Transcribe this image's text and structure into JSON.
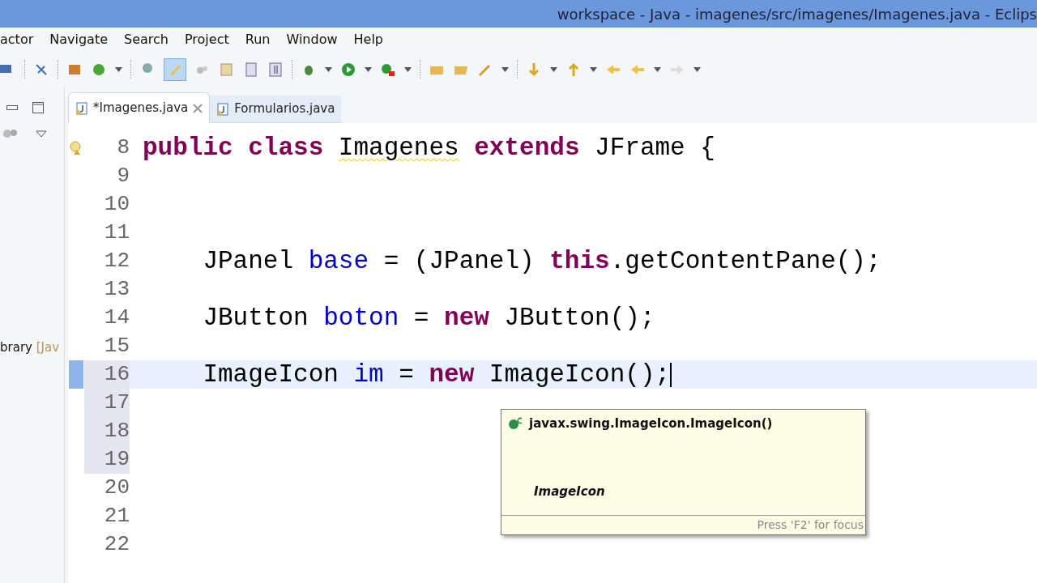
{
  "window": {
    "title": "workspace - Java - imagenes/src/imagenes/Imagenes.java - Eclips"
  },
  "menu": [
    "actor",
    "Navigate",
    "Search",
    "Project",
    "Run",
    "Window",
    "Help"
  ],
  "left_panel": {
    "item": {
      "name": "brary",
      "qualifier": "[Jav"
    }
  },
  "tabs": [
    {
      "label": "*Imagenes.java",
      "selected": true,
      "closable": true
    },
    {
      "label": "Formularios.java",
      "selected": false,
      "closable": false
    }
  ],
  "editor": {
    "lines": [
      {
        "number": "8",
        "kind": "warning",
        "current": false,
        "ruler": false,
        "indented": false,
        "tokens": [
          {
            "kind": "keyword",
            "text": "public class"
          },
          {
            "kind": "warning",
            "text": "Imagenes"
          },
          {
            "kind": "keyword",
            "text": "extends"
          },
          {
            "kind": "plain",
            "text": "JFrame {"
          }
        ]
      },
      {
        "number": "9",
        "kind": "plain",
        "current": false,
        "ruler": false
      },
      {
        "number": "10",
        "kind": "plain",
        "current": false,
        "ruler": false
      },
      {
        "number": "11",
        "kind": "plain",
        "current": false,
        "ruler": false
      },
      {
        "number": "12",
        "kind": "plain",
        "current": false,
        "ruler": false,
        "indented": true,
        "tokens": [
          {
            "kind": "plain",
            "text": "JPanel"
          },
          {
            "kind": "field",
            "text": "base"
          },
          {
            "kind": "plain",
            "text": "= (JPanel)"
          },
          {
            "kind": "keyword",
            "text": "this"
          },
          {
            "kind": "plain",
            "text": ".getContentPane();",
            "attached": true
          }
        ]
      },
      {
        "number": "13",
        "kind": "plain",
        "current": false,
        "ruler": false
      },
      {
        "number": "14",
        "kind": "plain",
        "current": false,
        "ruler": false,
        "indented": true,
        "tokens": [
          {
            "kind": "plain",
            "text": "JButton"
          },
          {
            "kind": "field",
            "text": "boton"
          },
          {
            "kind": "plain",
            "text": "="
          },
          {
            "kind": "keyword",
            "text": "new"
          },
          {
            "kind": "plain",
            "text": "JButton();"
          }
        ]
      },
      {
        "number": "15",
        "kind": "plain",
        "current": false,
        "ruler": false
      },
      {
        "number": "16",
        "kind": "selection",
        "current": true,
        "ruler": true,
        "indented": true,
        "tokens": [
          {
            "kind": "plain",
            "text": "ImageIcon"
          },
          {
            "kind": "field",
            "text": "im"
          },
          {
            "kind": "plain",
            "text": "="
          },
          {
            "kind": "keyword",
            "text": "new"
          },
          {
            "kind": "plain",
            "text": "ImageIcon();"
          }
        ]
      },
      {
        "number": "17",
        "kind": "plain",
        "current": false,
        "ruler": true
      },
      {
        "number": "18",
        "kind": "plain",
        "current": false,
        "ruler": true
      },
      {
        "number": "19",
        "kind": "plain",
        "current": false,
        "ruler": true
      },
      {
        "number": "20",
        "kind": "plain",
        "current": false,
        "ruler": false
      },
      {
        "number": "21",
        "kind": "plain",
        "current": false,
        "ruler": false
      },
      {
        "number": "22",
        "kind": "plain",
        "current": false,
        "ruler": false
      }
    ]
  },
  "popup": {
    "signature": "javax.swing.ImageIcon.ImageIcon()",
    "heading": "ImageIcon",
    "footer": "Press 'F2' for focus"
  }
}
